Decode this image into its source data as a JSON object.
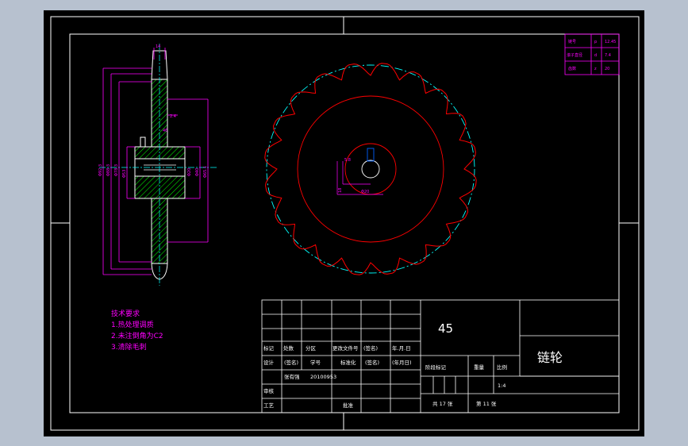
{
  "tech_requirements": {
    "title": "技术要求",
    "items": [
      "1.热处理调质",
      "2.未注倒角为C2",
      "3.清除毛刺"
    ]
  },
  "param_table": {
    "rows": [
      {
        "name": "链号",
        "symbol": "p",
        "value": "12.45"
      },
      {
        "name": "滚子直径",
        "symbol": "d",
        "value": "7.4"
      },
      {
        "name": "齿数",
        "symbol": "z",
        "value": "20"
      }
    ]
  },
  "title_block": {
    "material": "45",
    "part_name": "链轮",
    "row_header": [
      "标记",
      "处数",
      "分区",
      "更改文件号",
      "(签名)",
      "年.月.日"
    ],
    "design_row": [
      "设计",
      "(签名)",
      "学号",
      "标准化",
      "(签名)",
      "(年月日)"
    ],
    "student_id_label": "张有强",
    "student_id": "20100953",
    "check_label": "审核",
    "process_label": "工艺",
    "approve_label": "批准",
    "stage_header": [
      "阶段标记",
      "重量",
      "比例"
    ],
    "scale": "1:4",
    "sheets_total": "共 17 张",
    "sheet_no": "第 11 张"
  },
  "dimensions": {
    "side_view": [
      "Φ92.3",
      "Φ88.3",
      "Φ78.3",
      "Φ53",
      "2.4",
      "Φ20",
      "Φ40",
      "46",
      "Φ65.1",
      "14"
    ],
    "front_view": [
      "5.8",
      "Φ20",
      "18"
    ]
  },
  "colors": {
    "background": "#000000",
    "frame": "#ffffff",
    "dimension": "#ff00ff",
    "outline": "#ff0000",
    "hatch": "#00ff00",
    "center_line": "#00ffff",
    "text_white": "#ffffff"
  }
}
